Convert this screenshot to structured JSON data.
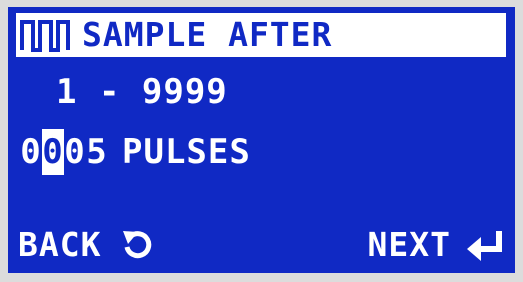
{
  "header": {
    "title": "SAMPLE AFTER",
    "icon": "pulse-train-icon"
  },
  "range_text": "1 - 9999",
  "value": {
    "digits": [
      "0",
      "0",
      "0",
      "5"
    ],
    "cursor_index": 1,
    "unit": "PULSES"
  },
  "softkeys": {
    "back_label": "BACK",
    "back_icon": "back-arrow-icon",
    "next_label": "NEXT",
    "next_icon": "enter-icon"
  },
  "colors": {
    "screen": "#1029c4",
    "text": "#ffffff"
  }
}
